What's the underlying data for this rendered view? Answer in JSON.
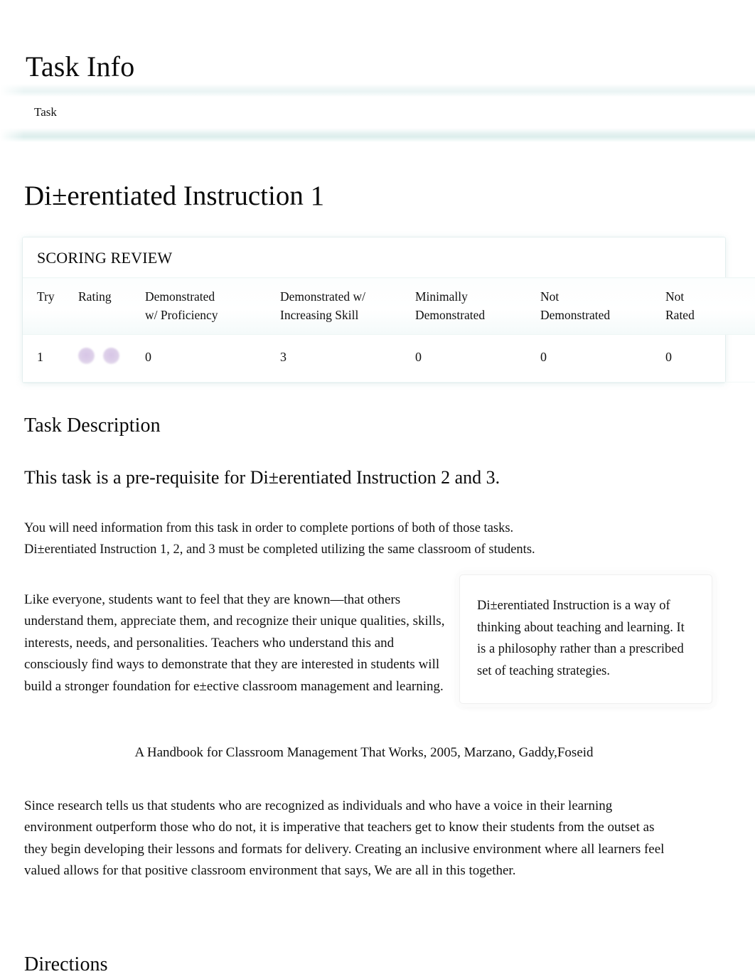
{
  "header": {
    "title": "Task Info",
    "breadcrumb": "Task"
  },
  "document": {
    "title": "Di±erentiated Instruction 1"
  },
  "scoring_review": {
    "caption": "SCORING REVIEW",
    "columns": [
      "Try",
      "Rating",
      "Demonstrated w/ Proficiency",
      "Demonstrated w/ Increasing Skill",
      "Minimally Demonstrated",
      "Not Demonstrated",
      "Not Rated"
    ],
    "column_lines": {
      "try": "Try",
      "rating": "Rating",
      "demonstrated_proficiency_l1": "Demonstrated",
      "demonstrated_proficiency_l2": "w/ Proficiency",
      "increasing_skill_l1": "Demonstrated w/",
      "increasing_skill_l2": "Increasing Skill",
      "minimally_l1": "Minimally",
      "minimally_l2": "Demonstrated",
      "not_demonstrated_l1": "Not",
      "not_demonstrated_l2": "Demonstrated",
      "not_rated_l1": "Not",
      "not_rated_l2": "Rated"
    },
    "rows": [
      {
        "try": "1",
        "rating_dots": 2,
        "demonstrated_proficiency": "0",
        "increasing_skill": "3",
        "minimally_demonstrated": "0",
        "not_demonstrated": "0",
        "not_rated": "0"
      }
    ],
    "rating_dot_color": "#ddd0e9"
  },
  "sections": {
    "task_description_heading": "Task Description",
    "directions_heading": "Directions",
    "lead": "This task is a pre-requisite for Di±erentiated Instruction 2 and 3.",
    "intro_line_1": "You will need information from this task in order to complete portions of both of those tasks.",
    "intro_line_2": "Di±erentiated Instruction 1, 2, and 3 must be completed utilizing the same classroom of students.",
    "body_paragraph": "Like everyone, students want to feel that they are   known—that others understand them, appreciate them, and recognize their unique qualities, skills, interests, needs, and personalities. Teachers who understand this and consciously find ways to demonstrate that they are interested in students will build a stronger foundation for e±ective classroom management and learning.",
    "callout": "Di±erentiated Instruction is a way of thinking about teaching and learning. It is a philosophy rather than a prescribed set of teaching strategies.",
    "citation": "A Handbook for Classroom Management That Works, 2005, Marzano, Gaddy,Foseid",
    "closing_paragraph": "Since research tells us that students who are recognized as individuals and who have a voice in their learning environment outperform those who do not, it is imperative that teachers get to know their students from the outset as they begin developing their lessons and formats for delivery. Creating an inclusive environment where all learners feel valued allows for that positive classroom environment that says, We are all in this together."
  },
  "theme": {
    "band_light": "#eaf4f4",
    "band_dark": "#dcedec",
    "accent_rating": "#ddd0e9",
    "text": "#111111"
  }
}
